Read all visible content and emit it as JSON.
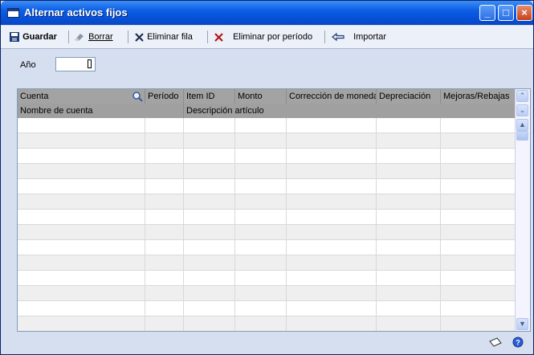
{
  "window": {
    "title": "Alternar activos fijos"
  },
  "toolbar": {
    "save": "Guardar",
    "clear": "Borrar",
    "delete_row": "Eliminar fila",
    "delete_by_period": "Eliminar por período",
    "import": "Importar"
  },
  "form": {
    "year_label": "Año",
    "year_value": ""
  },
  "grid": {
    "header1": [
      "Cuenta",
      "Período",
      "Item ID",
      "Monto",
      "Corrección de moneda",
      "Depreciación",
      "Mejoras/Rebajas"
    ],
    "header2": {
      "account_name": "Nombre de cuenta",
      "item_description": "Descripción artículo"
    },
    "row_count": 14
  },
  "colors": {
    "titlebar": "#0b5fe6",
    "header": "#a3a3a3",
    "body_bg": "#d6dff0"
  }
}
